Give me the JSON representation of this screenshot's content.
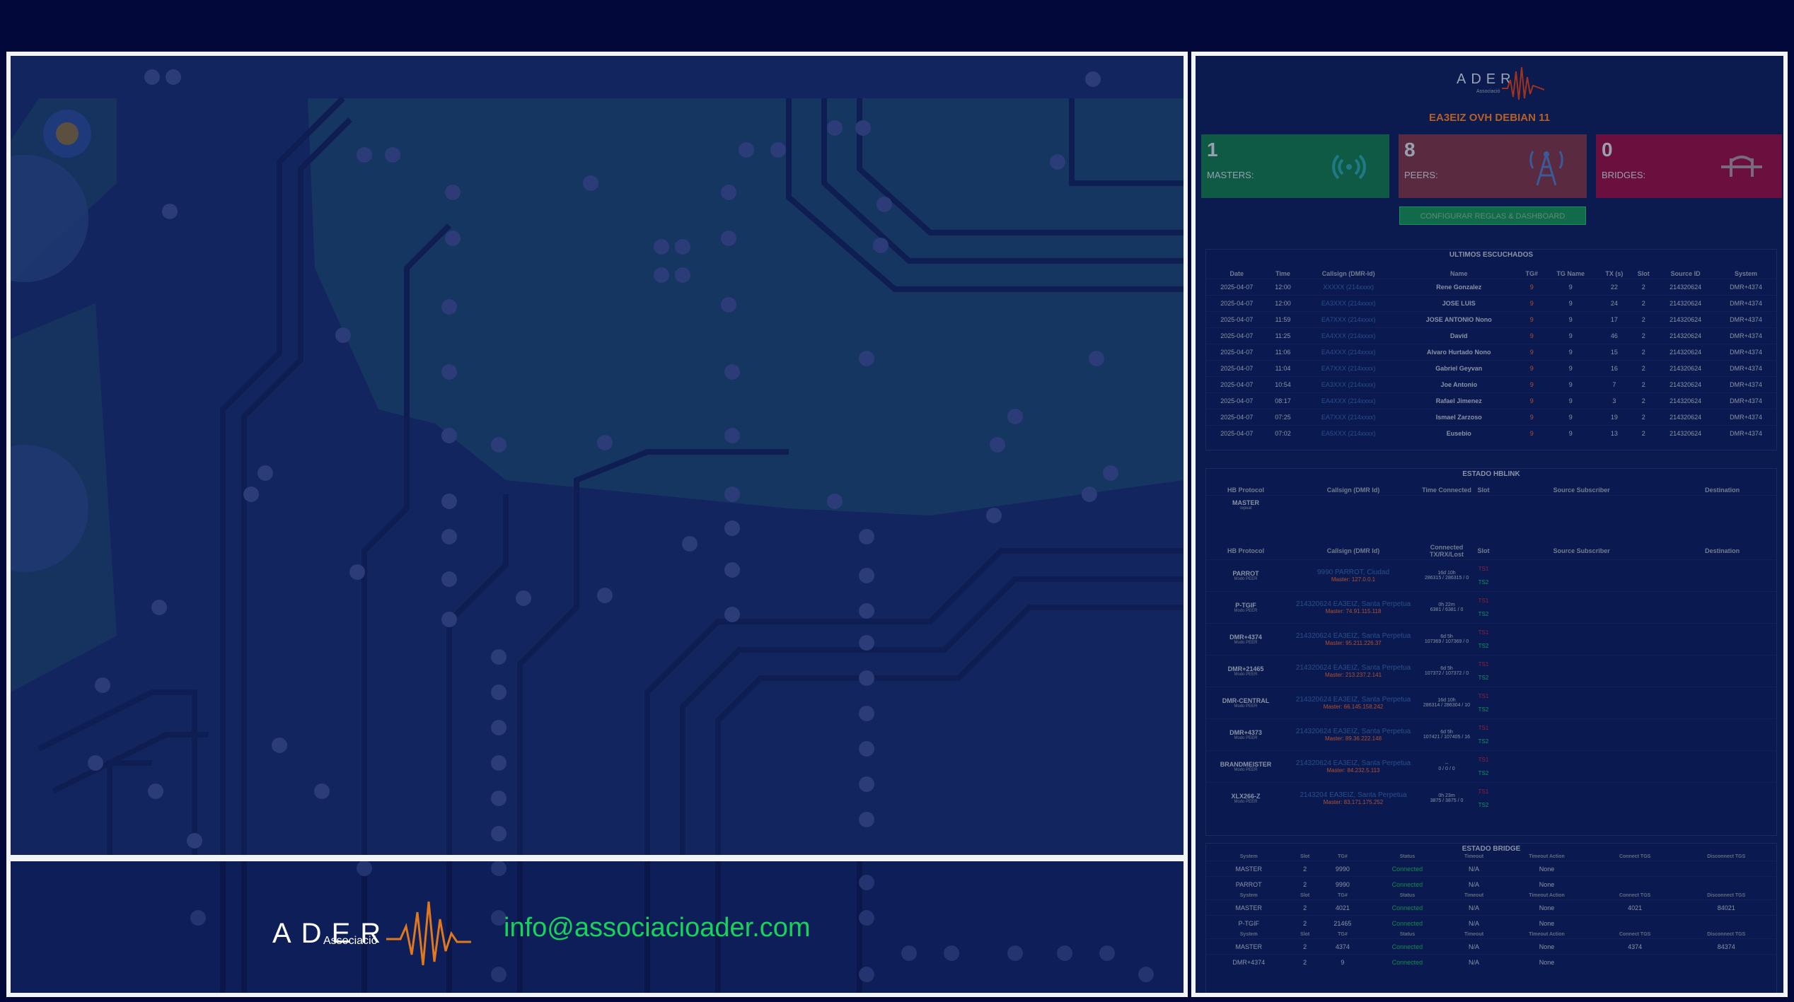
{
  "footer": {
    "logo_text": "ADER",
    "logo_subtext": "Associació",
    "email": "info@associacioader.com"
  },
  "dashboard": {
    "logo_text": "ADER",
    "logo_subtext": "Associació",
    "title": "EA3EIZ OVH DEBIAN 11",
    "cards": [
      {
        "count": "1",
        "label": "MASTERS:",
        "color": "#0f5a45",
        "icon": "broadcast-icon"
      },
      {
        "count": "8",
        "label": "PEERS:",
        "color": "#5a2a40",
        "icon": "tower-icon"
      },
      {
        "count": "0",
        "label": "BRIDGES:",
        "color": "#6b0f3e",
        "icon": "bridge-icon"
      }
    ],
    "config_button": "CONFIGURAR REGLAS & DASHBOARD",
    "last_heard": {
      "title": "ULTIMOS ESCUCHADOS",
      "columns": [
        "Date",
        "Time",
        "Callsign (DMR-Id)",
        "Name",
        "TG#",
        "TG Name",
        "TX (s)",
        "Slot",
        "Source ID",
        "System"
      ],
      "rows": [
        [
          "2025-04-07",
          "12:00",
          "XXXXX (214xxxx)",
          "Rene Gonzalez",
          "9",
          "9",
          "22",
          "2",
          "214320624",
          "DMR+4374"
        ],
        [
          "2025-04-07",
          "12:00",
          "EA3XXX (214xxxx)",
          "JOSE LUIS",
          "9",
          "9",
          "24",
          "2",
          "214320624",
          "DMR+4374"
        ],
        [
          "2025-04-07",
          "11:59",
          "EA7XXX (214xxxx)",
          "JOSE ANTONIO Nono",
          "9",
          "9",
          "17",
          "2",
          "214320624",
          "DMR+4374"
        ],
        [
          "2025-04-07",
          "11:25",
          "EA4XXX (214xxxx)",
          "David",
          "9",
          "9",
          "46",
          "2",
          "214320624",
          "DMR+4374"
        ],
        [
          "2025-04-07",
          "11:06",
          "EA4XXX (214xxxx)",
          "Alvaro Hurtado Nono",
          "9",
          "9",
          "15",
          "2",
          "214320624",
          "DMR+4374"
        ],
        [
          "2025-04-07",
          "11:04",
          "EA7XXX (214xxxx)",
          "Gabriel Geyvan",
          "9",
          "9",
          "16",
          "2",
          "214320624",
          "DMR+4374"
        ],
        [
          "2025-04-07",
          "10:54",
          "EA3XXX (214xxxx)",
          "Joe Antonio",
          "9",
          "9",
          "7",
          "2",
          "214320624",
          "DMR+4374"
        ],
        [
          "2025-04-07",
          "08:17",
          "EA4XXX (214xxxx)",
          "Rafael Jimenez",
          "9",
          "9",
          "3",
          "2",
          "214320624",
          "DMR+4374"
        ],
        [
          "2025-04-07",
          "07:25",
          "EA7XXX (214xxxx)",
          "Ismael Zarzoso",
          "9",
          "9",
          "19",
          "2",
          "214320624",
          "DMR+4374"
        ],
        [
          "2025-04-07",
          "07:02",
          "EA5XXX (214xxxx)",
          "Eusebio",
          "9",
          "9",
          "13",
          "2",
          "214320624",
          "DMR+4374"
        ]
      ]
    },
    "hblink": {
      "title": "ESTADO HBLINK",
      "master_columns": [
        "HB Protocol",
        "Callsign (DMR Id)",
        "Time Connected",
        "Slot",
        "Source Subscriber",
        "Destination"
      ],
      "master_row": {
        "name": "MASTER",
        "mode": "repeat"
      },
      "peer_columns": [
        "HB Protocol",
        "Callsign (DMR Id)",
        "Connected TX/RX/Lost",
        "Slot",
        "Source Subscriber",
        "Destination"
      ],
      "peers": [
        {
          "name": "PARROT",
          "mode": "Modo PEER",
          "call": "9990 PARROT, Ciudad",
          "master": "Master: 127.0.0.1",
          "time": "16d 10h",
          "stats": "286315 / 286315 / 0"
        },
        {
          "name": "P-TGIF",
          "mode": "Modo PEER",
          "call": "214320624 EA3EIZ, Santa Perpetua",
          "master": "Master: 74.91.115.118",
          "time": "0h 22m",
          "stats": "6381 / 6381 / 0"
        },
        {
          "name": "DMR+4374",
          "mode": "Modo PEER",
          "call": "214320624 EA3EIZ, Santa Perpetua",
          "master": "Master: 95.211.226.37",
          "time": "6d 5h",
          "stats": "107369 / 107369 / 0"
        },
        {
          "name": "DMR+21465",
          "mode": "Modo PEER",
          "call": "214320624 EA3EIZ, Santa Perpetua",
          "master": "Master: 213.237.2.141",
          "time": "6d 5h",
          "stats": "107372 / 107372 / 0"
        },
        {
          "name": "DMR-CENTRAL",
          "mode": "Modo PEER",
          "call": "214320624 EA3EIZ, Santa Perpetua",
          "master": "Master: 66.145.158.242",
          "time": "16d 10h",
          "stats": "286314 / 286304 / 10"
        },
        {
          "name": "DMR+4373",
          "mode": "Modo PEER",
          "call": "214320624 EA3EIZ, Santa Perpetua",
          "master": "Master: 89.36.222.148",
          "time": "6d 5h",
          "stats": "107421 / 107405 / 16"
        },
        {
          "name": "BRANDMEISTER",
          "mode": "Modo PEER",
          "call": "214320624 EA3EIZ, Santa Perpetua",
          "master": "Master: 84.232.5.113",
          "time": "--",
          "stats": "0 / 0 / 0"
        },
        {
          "name": "XLX266-Z",
          "mode": "Modo PEER",
          "call": "2143204 EA3EIZ, Santa Perpetua",
          "master": "Master: 83.171.175.252",
          "time": "0h 23m",
          "stats": "3875 / 3875 / 0"
        }
      ],
      "ts1": "TS1",
      "ts2": "TS2"
    },
    "bridge": {
      "title": "ESTADO BRIDGE",
      "columns": [
        "System",
        "Slot",
        "TG#",
        "Status",
        "Timeout",
        "Timeout Action",
        "Connect TGS",
        "Disconnect TGS"
      ],
      "groups": [
        [
          [
            "MASTER",
            "2",
            "9990",
            "Connected",
            "N/A",
            "None",
            "",
            ""
          ],
          [
            "PARROT",
            "2",
            "9990",
            "Connected",
            "N/A",
            "None",
            "",
            ""
          ]
        ],
        [
          [
            "MASTER",
            "2",
            "4021",
            "Connected",
            "N/A",
            "None",
            "4021",
            "84021"
          ],
          [
            "P-TGIF",
            "2",
            "21465",
            "Connected",
            "N/A",
            "None",
            "",
            ""
          ]
        ],
        [
          [
            "MASTER",
            "2",
            "4374",
            "Connected",
            "N/A",
            "None",
            "4374",
            "84374"
          ],
          [
            "DMR+4374",
            "2",
            "9",
            "Connected",
            "N/A",
            "None",
            "",
            ""
          ]
        ]
      ]
    }
  }
}
